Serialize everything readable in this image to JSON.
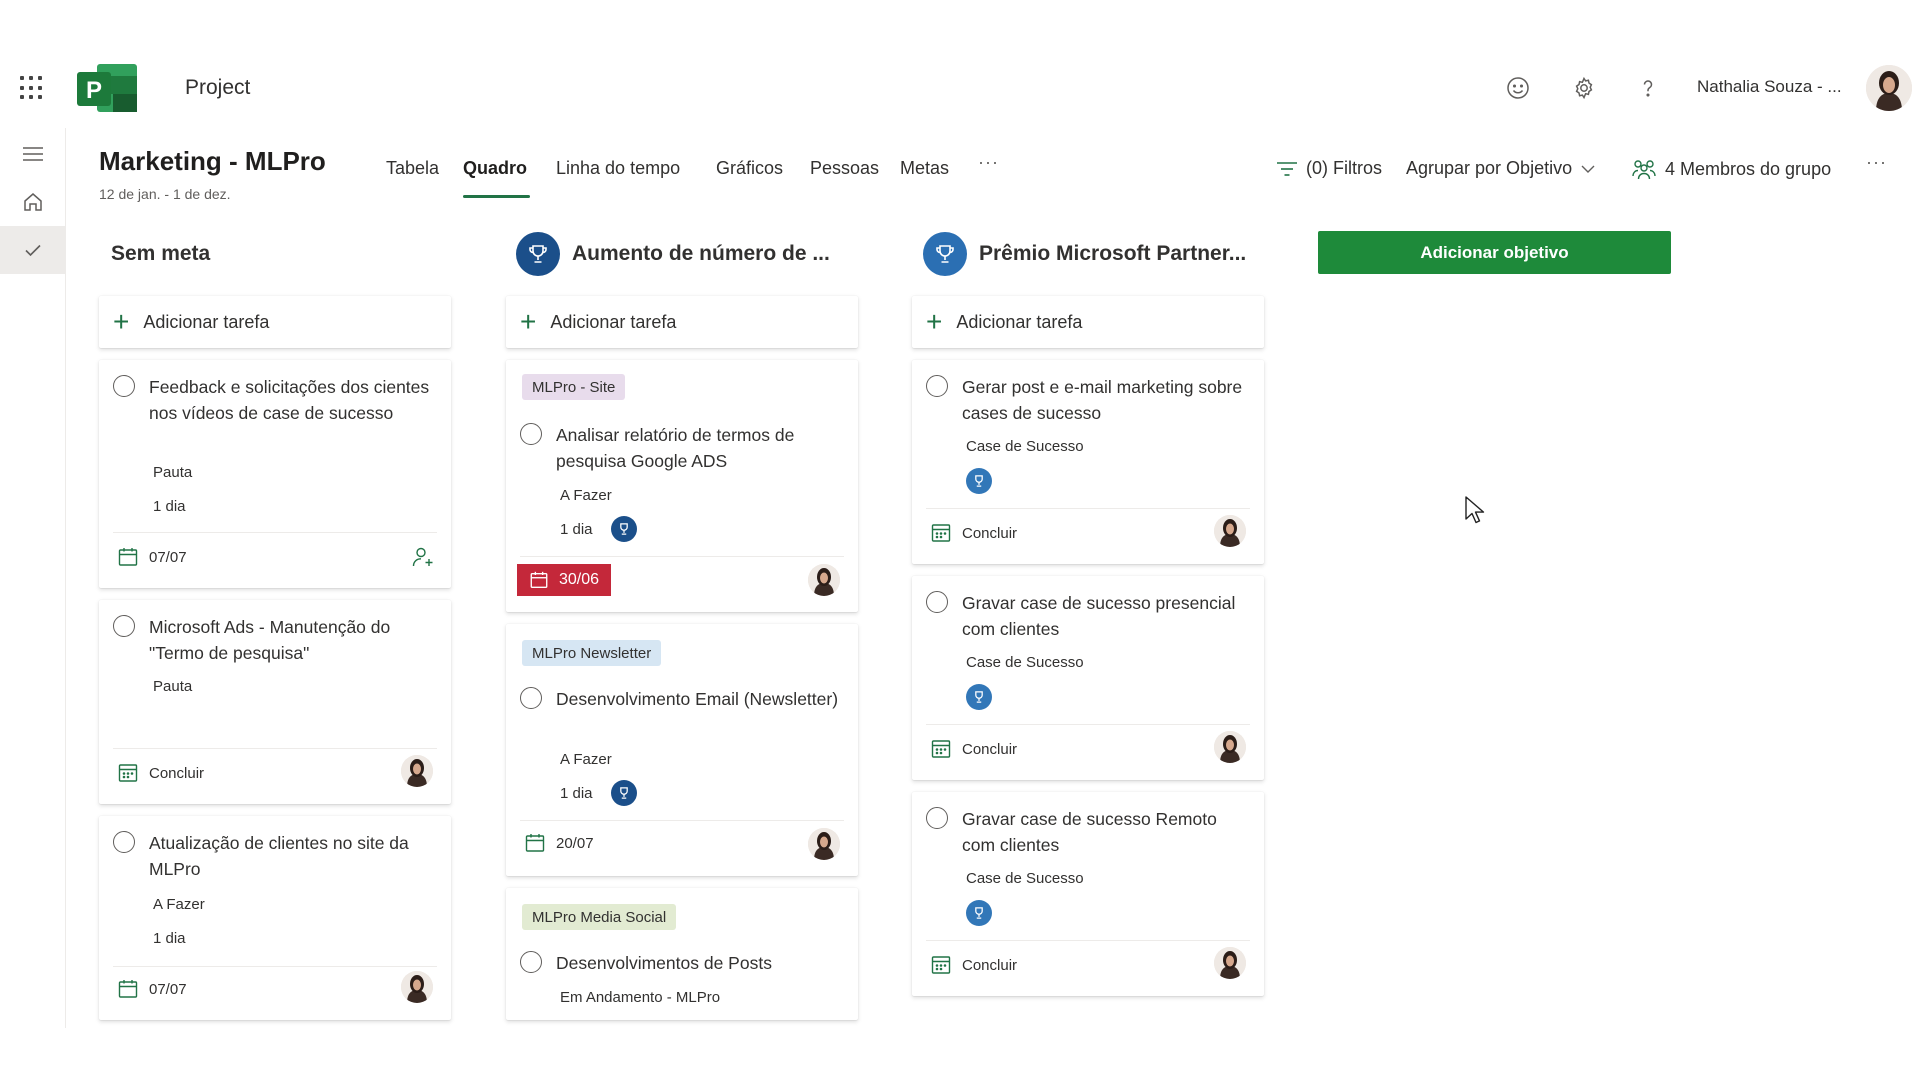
{
  "app": {
    "title": "Project",
    "logo_letter": "P"
  },
  "header": {
    "user_name": "Nathalia Souza - ...",
    "icons": [
      "waffle-icon",
      "smiley-icon",
      "gear-icon",
      "help-icon"
    ]
  },
  "project": {
    "title": "Marketing - MLPro",
    "dates": "12 de jan. - 1 de dez."
  },
  "tabs": [
    {
      "label": "Tabela"
    },
    {
      "label": "Quadro",
      "active": true
    },
    {
      "label": "Linha do tempo"
    },
    {
      "label": "Gráficos"
    },
    {
      "label": "Pessoas"
    },
    {
      "label": "Metas"
    }
  ],
  "toolbar": {
    "more": "···",
    "filters": "(0) Filtros",
    "group_by": "Agrupar por Objetivo",
    "members": "4 Membros do grupo",
    "overflow": "···"
  },
  "add_goal_label": "Adicionar objetivo",
  "add_task_label": "Adicionar tarefa",
  "columns": [
    {
      "title": "Sem meta",
      "cards": [
        {
          "title": "Feedback e solicitações dos cientes nos vídeos de case de sucesso",
          "bucket": "Pauta",
          "duration": "1 dia",
          "date": "07/07",
          "assignee": "unassigned"
        },
        {
          "title": "Microsoft Ads - Manutenção do \"Termo de pesquisa\"",
          "bucket": "Pauta",
          "date": "Concluir",
          "assignee": "user"
        },
        {
          "title": "Atualização de clientes no site da MLPro",
          "bucket": "A Fazer",
          "duration": "1 dia",
          "date": "07/07",
          "assignee": "user"
        }
      ]
    },
    {
      "title": "Aumento de número de ...",
      "cards": [
        {
          "label": "MLPro - Site",
          "label_color": "#e8dcec",
          "title": "Analisar relatório de termos de pesquisa Google ADS",
          "bucket": "A Fazer",
          "duration": "1 dia",
          "date": "30/06",
          "overdue": true
        },
        {
          "label": "MLPro Newsletter",
          "label_color": "#d6e6f3",
          "title": "Desenvolvimento Email (Newsletter)",
          "bucket": "A Fazer",
          "duration": "1 dia",
          "date": "20/07"
        },
        {
          "label": "MLPro Media Social",
          "label_color": "#e2ebd2",
          "title": "Desenvolvimentos de Posts",
          "bucket": "Em Andamento - MLPro"
        }
      ]
    },
    {
      "title": "Prêmio Microsoft Partner...",
      "cards": [
        {
          "title": "Gerar post e e-mail marketing sobre cases de sucesso",
          "bucket": "Case de Sucesso",
          "date": "Concluir"
        },
        {
          "title": "Gravar case de sucesso presencial com clientes",
          "bucket": "Case de Sucesso",
          "date": "Concluir"
        },
        {
          "title": "Gravar case de sucesso Remoto com clientes",
          "bucket": "Case de Sucesso",
          "date": "Concluir"
        }
      ]
    }
  ],
  "colors": {
    "accent_green": "#217346",
    "button_green": "#1e8a3a",
    "goal_blue": "#1b4f8a",
    "overdue_red": "#c4283a"
  }
}
